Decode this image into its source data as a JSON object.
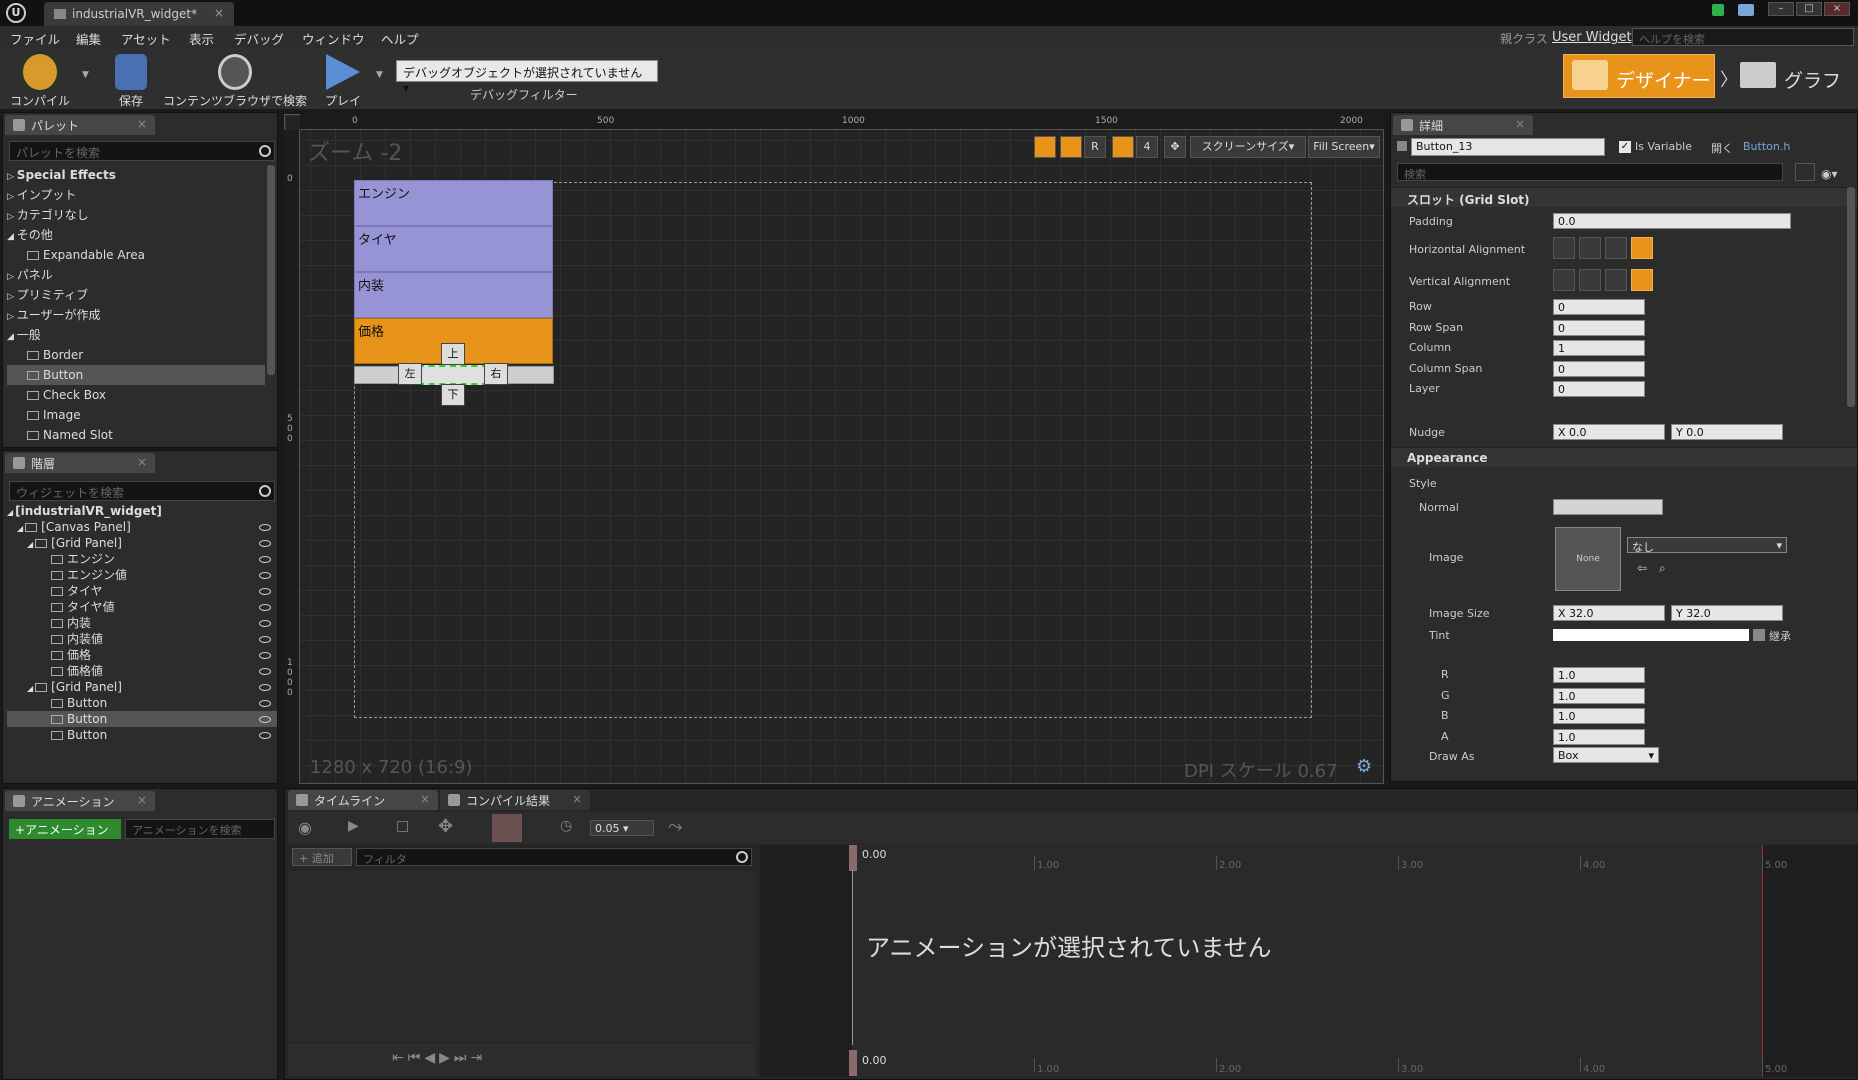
{
  "window": {
    "tab_title": "industrialVR_widget*",
    "logo": "U",
    "parent_class_label": "親クラス",
    "parent_class_value": "User Widget",
    "help_search_placeholder": "ヘルプを検索"
  },
  "menu": [
    "ファイル",
    "編集",
    "アセット",
    "表示",
    "デバッグ",
    "ウィンドウ",
    "ヘルプ"
  ],
  "toolbar": {
    "compile": "コンパイル",
    "save": "保存",
    "browse": "コンテンツブラウザで検索",
    "play": "プレイ",
    "debug_select": "デバッグオブジェクトが選択されていません",
    "debug_filter": "デバッグフィルター",
    "designer": "デザイナー",
    "graph": "グラフ"
  },
  "palette": {
    "tab": "パレット",
    "search_placeholder": "パレットを検索",
    "items": [
      {
        "label": "Special Effects",
        "kind": "category",
        "bold": true
      },
      {
        "label": "インプット",
        "kind": "category"
      },
      {
        "label": "カテゴリなし",
        "kind": "category"
      },
      {
        "label": "その他",
        "kind": "category-open"
      },
      {
        "label": "Expandable Area",
        "kind": "widget"
      },
      {
        "label": "パネル",
        "kind": "category"
      },
      {
        "label": "プリミティブ",
        "kind": "category"
      },
      {
        "label": "ユーザーが作成",
        "kind": "category"
      },
      {
        "label": "一般",
        "kind": "category-open"
      },
      {
        "label": "Border",
        "kind": "widget"
      },
      {
        "label": "Button",
        "kind": "widget",
        "selected": true
      },
      {
        "label": "Check Box",
        "kind": "widget"
      },
      {
        "label": "Image",
        "kind": "widget"
      },
      {
        "label": "Named Slot",
        "kind": "widget"
      }
    ]
  },
  "hierarchy": {
    "tab": "階層",
    "search_placeholder": "ウィジェットを検索",
    "items": [
      {
        "label": "[industrialVR_widget]",
        "depth": 0,
        "bold": true
      },
      {
        "label": "[Canvas Panel]",
        "depth": 1
      },
      {
        "label": "[Grid Panel]",
        "depth": 2
      },
      {
        "label": "エンジン",
        "depth": 3
      },
      {
        "label": "エンジン値",
        "depth": 3
      },
      {
        "label": "タイヤ",
        "depth": 3
      },
      {
        "label": "タイヤ値",
        "depth": 3
      },
      {
        "label": "内装",
        "depth": 3
      },
      {
        "label": "内装値",
        "depth": 3
      },
      {
        "label": "価格",
        "depth": 3
      },
      {
        "label": "価格値",
        "depth": 3
      },
      {
        "label": "[Grid Panel]",
        "depth": 2
      },
      {
        "label": "Button",
        "depth": 3
      },
      {
        "label": "Button",
        "depth": 3,
        "selected": true
      },
      {
        "label": "Button",
        "depth": 3
      }
    ]
  },
  "designer": {
    "zoom": "ズーム -2",
    "ruler_top": [
      "0",
      "500",
      "1000",
      "1500",
      "2000"
    ],
    "ruler_left": [
      "0",
      "500",
      "1000"
    ],
    "cells": [
      "エンジン",
      "タイヤ",
      "内装",
      "価格"
    ],
    "arrows": {
      "up": "上",
      "down": "下",
      "left": "左",
      "right": "右"
    },
    "canvas_size": "1280 x 720 (16:9)",
    "dpi": "DPI スケール 0.67",
    "toolbar_r": "R",
    "toolbar_4": "4",
    "screen_size": "スクリーンサイズ",
    "fill_screen": "Fill Screen"
  },
  "details": {
    "tab": "詳細",
    "name": "Button_13",
    "is_variable": "Is Variable",
    "open_label": "開く",
    "open_file": "Button.h",
    "search_placeholder": "検索",
    "slot_header": "スロット (Grid Slot)",
    "padding_label": "Padding",
    "padding": "0.0",
    "halign": "Horizontal Alignment",
    "valign": "Vertical Alignment",
    "rows": [
      {
        "label": "Row",
        "value": "0"
      },
      {
        "label": "Row Span",
        "value": "0"
      },
      {
        "label": "Column",
        "value": "1"
      },
      {
        "label": "Column Span",
        "value": "0"
      },
      {
        "label": "Layer",
        "value": "0"
      }
    ],
    "nudge": "Nudge",
    "nudge_x": "0.0",
    "nudge_y": "0.0",
    "x": "X",
    "y": "Y",
    "appearance": "Appearance",
    "style": "Style",
    "normal": "Normal",
    "image": "Image",
    "image_none": "None",
    "image_select": "なし",
    "image_size": "Image Size",
    "image_size_x": "32.0",
    "image_size_y": "32.0",
    "tint": "Tint",
    "inherit": "継承",
    "rgba": [
      {
        "label": "R",
        "value": "1.0"
      },
      {
        "label": "G",
        "value": "1.0"
      },
      {
        "label": "B",
        "value": "1.0"
      },
      {
        "label": "A",
        "value": "1.0"
      }
    ],
    "draw_as": "Draw As",
    "draw_as_value": "Box"
  },
  "animation": {
    "tab": "アニメーション",
    "add": "+アニメーション",
    "search_placeholder": "アニメーションを検索"
  },
  "timeline": {
    "tab": "タイムライン",
    "compile_tab": "コンパイル結果",
    "value": "0.05",
    "add": "+ 追加",
    "filter": "フィルタ",
    "cursor": "0.00",
    "ticks": [
      "0.00",
      "1.00",
      "2.00",
      "3.00",
      "4.00",
      "5.00"
    ],
    "empty": "アニメーションが選択されていません"
  }
}
